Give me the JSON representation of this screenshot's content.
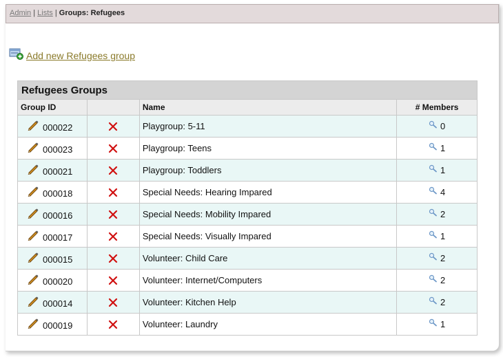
{
  "breadcrumb": {
    "admin": "Admin",
    "sep1": " | ",
    "lists": "Lists",
    "sep2": " | ",
    "current": "Groups: Refugees"
  },
  "add_link": "Add new Refugees group",
  "table": {
    "caption": "Refugees Groups",
    "headers": {
      "group_id": "Group ID",
      "delete": "",
      "name": "Name",
      "members": "# Members"
    },
    "rows": [
      {
        "id": "000022",
        "name": "Playgroup: 5-11",
        "members": "0"
      },
      {
        "id": "000023",
        "name": "Playgroup: Teens",
        "members": "1"
      },
      {
        "id": "000021",
        "name": "Playgroup: Toddlers",
        "members": "1"
      },
      {
        "id": "000018",
        "name": "Special Needs: Hearing Impared",
        "members": "4"
      },
      {
        "id": "000016",
        "name": "Special Needs: Mobility Impared",
        "members": "2"
      },
      {
        "id": "000017",
        "name": "Special Needs: Visually Impared",
        "members": "1"
      },
      {
        "id": "000015",
        "name": "Volunteer: Child Care",
        "members": "2"
      },
      {
        "id": "000020",
        "name": "Volunteer: Internet/Computers",
        "members": "2"
      },
      {
        "id": "000014",
        "name": "Volunteer: Kitchen Help",
        "members": "2"
      },
      {
        "id": "000019",
        "name": "Volunteer: Laundry",
        "members": "1"
      }
    ]
  },
  "colors": {
    "breadcrumb_bg": "#e3dadb",
    "alt_row_bg": "#e9f7f6",
    "caption_bg": "#d4d4d4",
    "header_bg": "#ececec",
    "delete_icon": "#d01010",
    "link_color": "#8a7a2a"
  },
  "icons": {
    "add": "add-group-icon",
    "edit": "pencil-icon",
    "delete": "delete-x-icon",
    "members": "magnifier-icon"
  }
}
